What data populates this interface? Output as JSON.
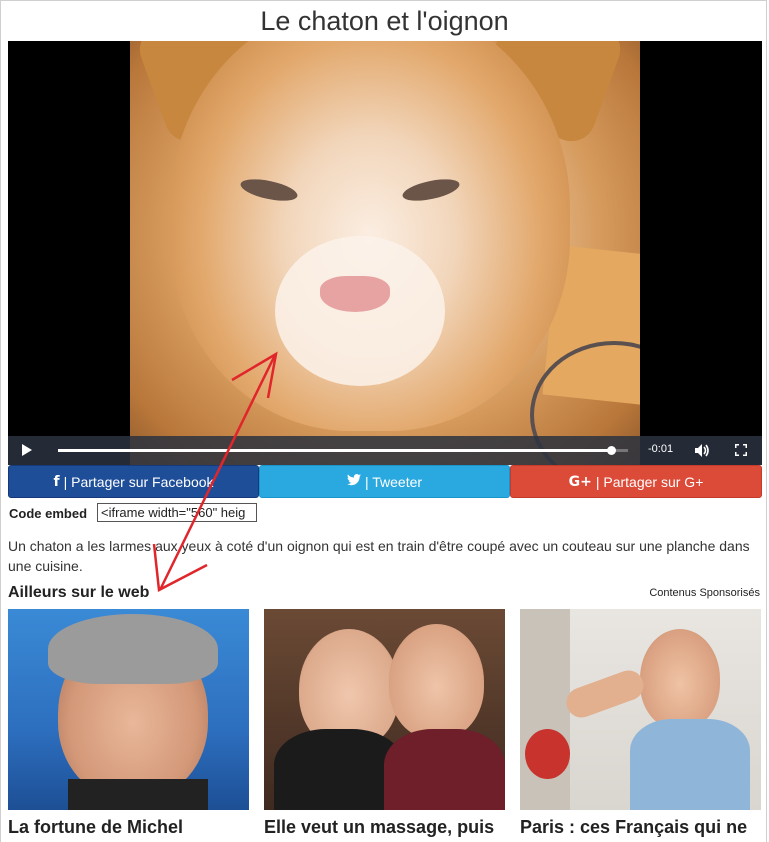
{
  "page": {
    "title": "Le chaton et l'oignon"
  },
  "player": {
    "time": "-0:01",
    "progress_fraction": 0.97
  },
  "share": {
    "facebook_icon": "f",
    "facebook_label": "| Partager sur Facebook",
    "twitter_icon": "🐦",
    "twitter_label": "| Tweeter",
    "gplus_icon": "G+",
    "gplus_label": "| Partager sur G+"
  },
  "embed": {
    "label": "Code embed",
    "value": "<iframe width=\"560\" heig"
  },
  "description": "Un chaton a les larmes aux yeux à coté d'un oignon qui est en train d'être coupé avec un couteau sur une planche dans une cuisine.",
  "elsewhere": {
    "heading": "Ailleurs sur le web",
    "sponsored": "Contenus Sponsorisés",
    "cards": [
      {
        "title": "La fortune de Michel"
      },
      {
        "title": "Elle veut un massage, puis"
      },
      {
        "title": "Paris : ces Français qui ne"
      }
    ]
  },
  "colors": {
    "facebook": "#1f4e99",
    "twitter": "#2aa9e0",
    "gplus": "#dc4a38",
    "annotation_arrow": "#e0262b"
  },
  "icons": [
    "play-icon",
    "volume-icon",
    "fullscreen-icon",
    "facebook-icon",
    "twitter-icon",
    "google-plus-icon"
  ]
}
